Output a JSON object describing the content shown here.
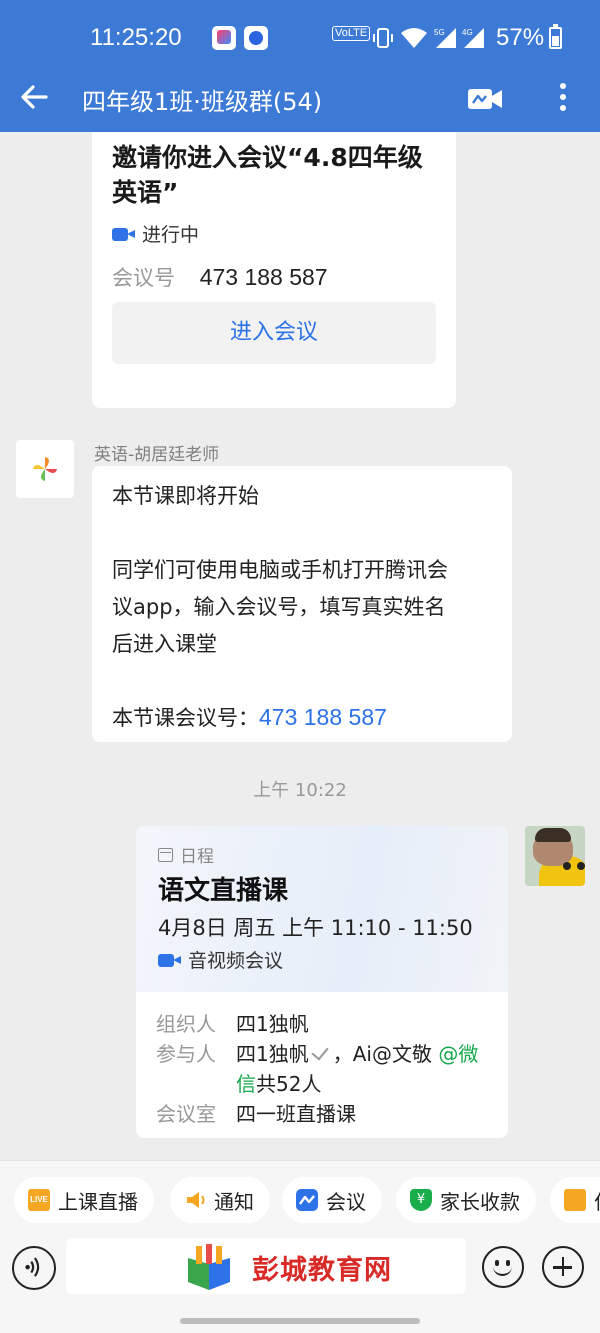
{
  "status_bar": {
    "time": "11:25:20",
    "volte_label": "Vo¹ LTE 2",
    "battery": "57%",
    "network_labels": [
      "5G",
      "4G"
    ]
  },
  "header": {
    "title": "四年级1班·班级群(54)"
  },
  "meeting_card": {
    "title": "邀请你进入会议“4.8四年级英语”",
    "status": "进行中",
    "id_label": "会议号",
    "id_value": "473 188 587",
    "join_label": "进入会议"
  },
  "message": {
    "sender": "英语-胡居廷老师",
    "line1": "本节课即将开始",
    "line2": "同学们可使用电脑或手机打开腾讯会",
    "line3": "议app，输入会议号，填写真实姓名",
    "line4": "后进入课堂",
    "line5_label": "本节课会议号：",
    "line5_value": "473 188 587"
  },
  "timestamp": "上午 10:22",
  "schedule_card": {
    "category": "日程",
    "title": "语文直播课",
    "time": "4月8日 周五 上午 11:10 - 11:50",
    "type": "音视频会议",
    "organizer_label": "组织人",
    "organizer_value": "四1独帆",
    "participants_label": "参与人",
    "participants_part1": "四1独帆",
    "participants_part2": "Ai@文敬",
    "participants_tag_a": "@微",
    "participants_tag_b": "信",
    "participants_count": "共52人",
    "room_label": "会议室",
    "room_value": "四一班直播课"
  },
  "quick_actions": [
    {
      "label": "上课直播",
      "icon": "live-icon"
    },
    {
      "label": "通知",
      "icon": "megaphone-icon"
    },
    {
      "label": "会议",
      "icon": "meeting-icon"
    },
    {
      "label": "家长收款",
      "icon": "payment-icon"
    },
    {
      "label": "作",
      "icon": "clipboard-icon"
    }
  ],
  "live_icon_text": "LIVE",
  "pay_icon_text": "¥",
  "input_bar": {
    "logo_text": "彭城教育网"
  },
  "colors": {
    "header_bg": "#3d7ad6",
    "accent": "#2d72e6",
    "green": "#15a84a",
    "logo_red": "#d82a26"
  }
}
